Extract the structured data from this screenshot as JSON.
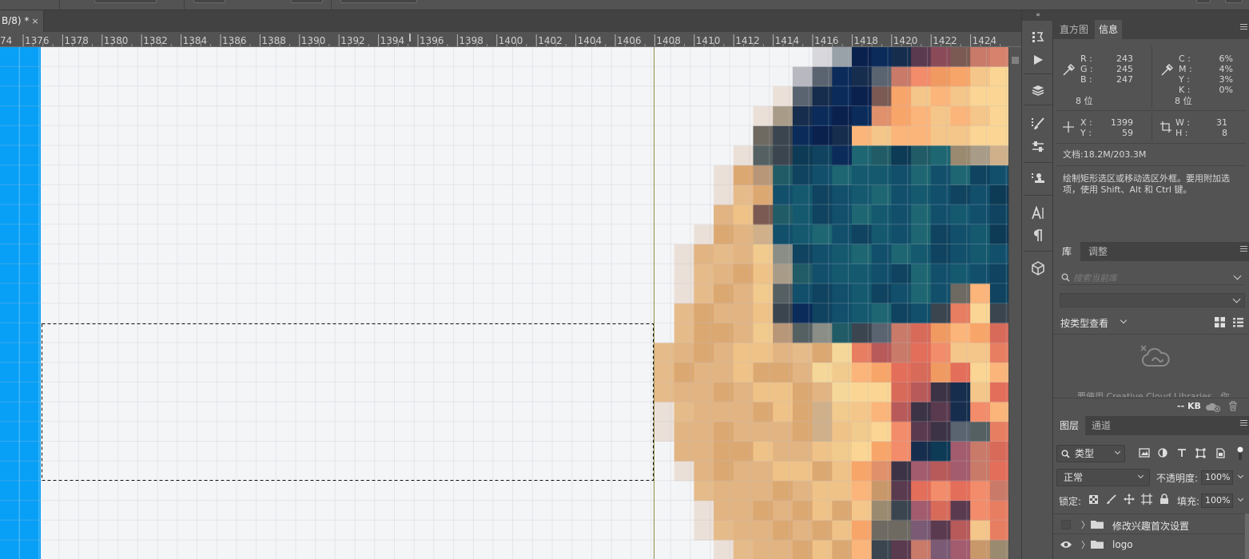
{
  "document": {
    "tab_title": "B/8) *",
    "close_symbol": "×"
  },
  "ruler": {
    "first_partial": "74",
    "labels": [
      "1376",
      "1378",
      "1380",
      "1382",
      "1384",
      "1386",
      "1388",
      "1390",
      "1392",
      "1394",
      "1396",
      "1398",
      "1400",
      "1402",
      "1404",
      "1406",
      "1408",
      "1410",
      "1412",
      "1414",
      "1416",
      "1418",
      "1420",
      "1422",
      "1424"
    ]
  },
  "panels": {
    "collapse_glyph": "«",
    "info_tabs": {
      "histogram": "直方图",
      "info": "信息"
    },
    "info": {
      "rgb_labels": [
        "R :",
        "G :",
        "B :"
      ],
      "rgb_values": [
        "243",
        "245",
        "247"
      ],
      "cmyk_labels": [
        "C :",
        "M :",
        "Y :",
        "K :"
      ],
      "cmyk_values": [
        "6%",
        "4%",
        "3%",
        "0%"
      ],
      "bits_left": "8 位",
      "bits_right": "8 位",
      "xy_labels": [
        "X :",
        "Y :"
      ],
      "xy_values": [
        "1399",
        "59"
      ],
      "wh_labels": [
        "W :",
        "H :"
      ],
      "wh_values": [
        "31",
        "8"
      ],
      "document_size": "文档:18.2M/203.3M",
      "hint": "绘制矩形选区或移动选区外框。要用附加选项，使用 Shift、Alt 和 Ctrl 键。"
    },
    "library_tabs": {
      "library": "库",
      "adjust": "调整"
    },
    "library": {
      "search_placeholder": "搜索当前库",
      "view_by": "按类型查看",
      "cloud_message": "要使用 Creative Cloud Libraries，你",
      "size": "-- KB"
    },
    "layers_tabs": {
      "layers": "图层",
      "channels": "通道"
    },
    "layers": {
      "kind_filter": "类型",
      "blend_mode": "正常",
      "opacity_label": "不透明度:",
      "opacity_value": "100%",
      "lock_label": "锁定:",
      "fill_label": "填充:",
      "fill_value": "100%",
      "items": [
        {
          "name": "修改兴趣首次设置",
          "visible": false
        },
        {
          "name": "logo",
          "visible": true
        }
      ]
    }
  },
  "colors": {
    "canvas_bg": "#f4f5f7",
    "blue_band": "#08a0f7",
    "ui_bg": "#535353",
    "dark_bar": "#424242"
  },
  "icons": {
    "tool_strip": [
      "history-brush-icon",
      "play-icon",
      "3d-cube-stack-icon",
      "brush-settings-icon",
      "sliders-icon",
      "clone-source-icon",
      "character-icon",
      "paragraph-icon",
      "3d-box-icon"
    ]
  }
}
